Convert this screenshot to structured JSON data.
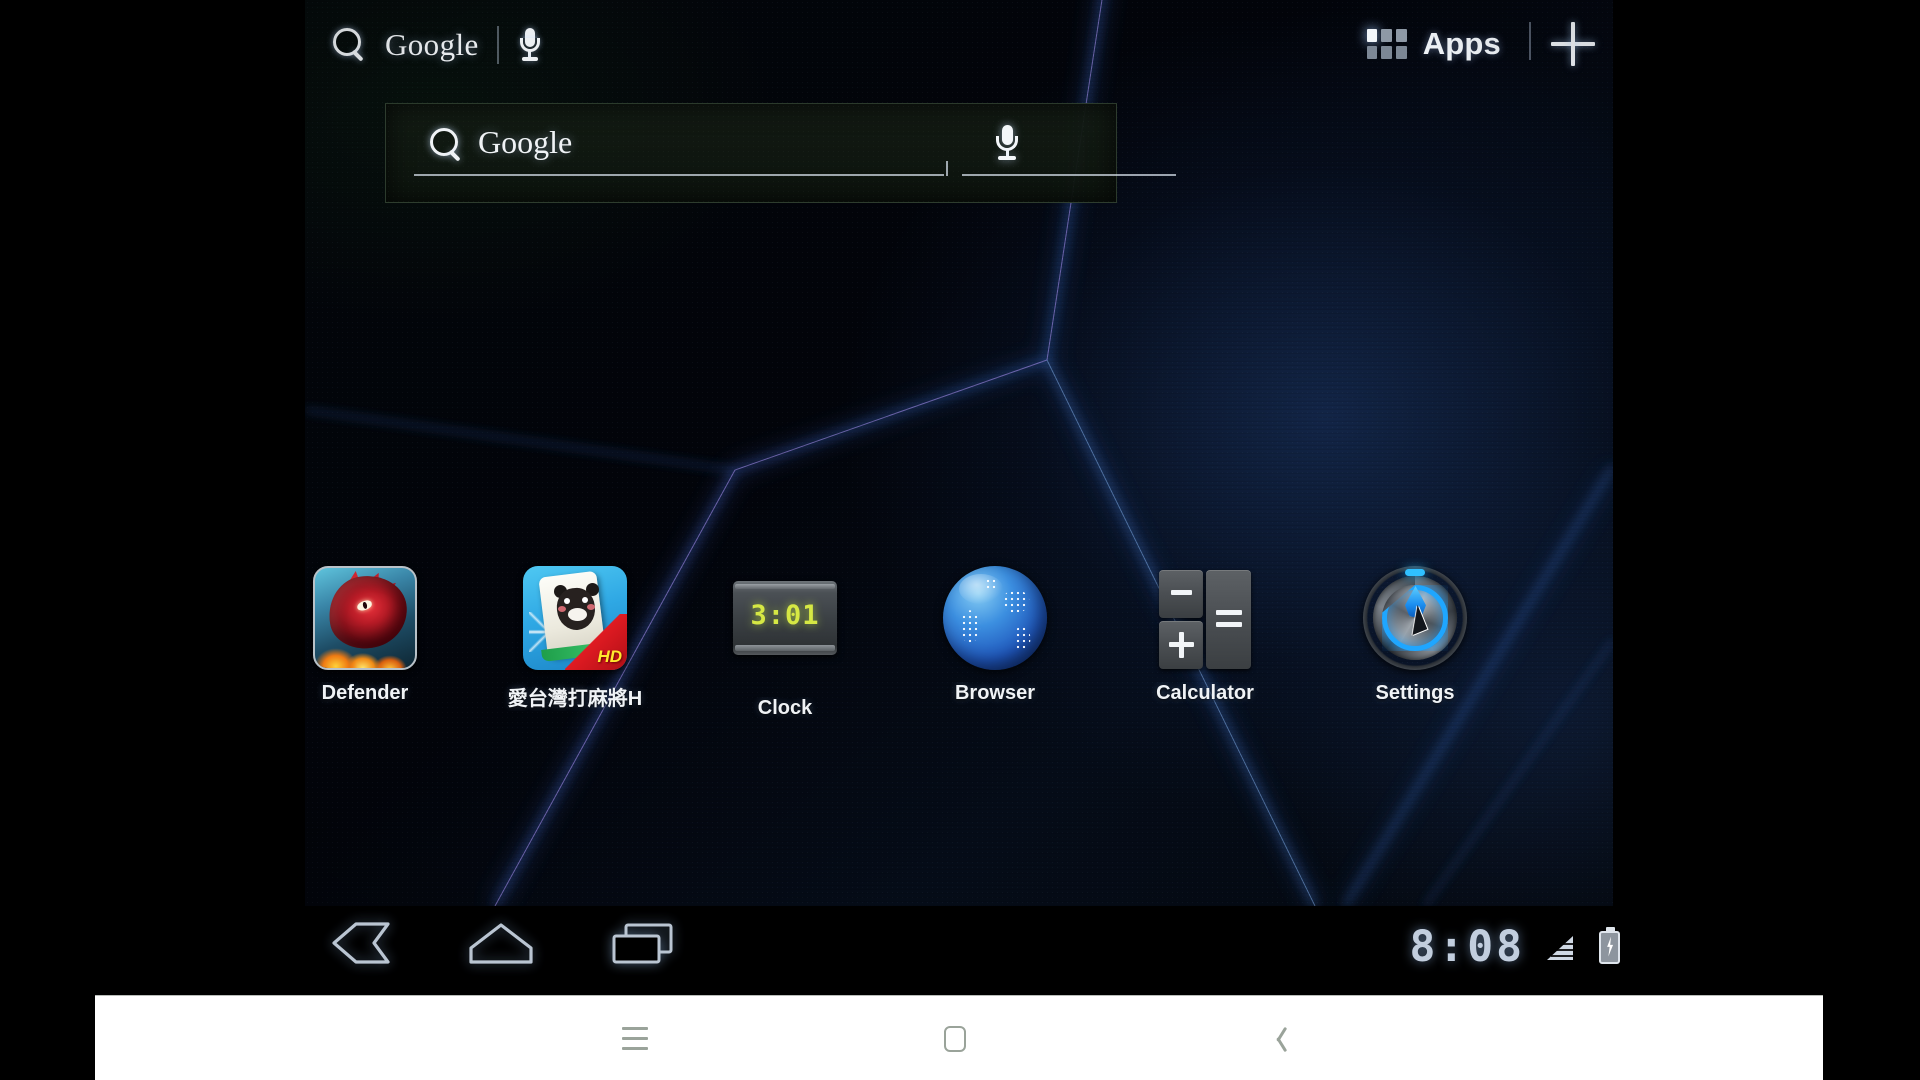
{
  "topbar": {
    "search_label": "Google",
    "search_icon": "search-icon",
    "mic_icon": "microphone-icon",
    "apps_label": "Apps",
    "apps_icon": "grid-icon",
    "add_icon": "plus-icon"
  },
  "search_widget": {
    "placeholder": "Google",
    "search_icon": "search-icon",
    "voice_icon": "microphone-icon"
  },
  "apps": [
    {
      "label": "Defender",
      "icon": "defender-dragon-icon"
    },
    {
      "label": "愛台灣打麻將H",
      "icon": "mahjong-panda-hd-icon",
      "badge": "HD"
    },
    {
      "label": "Clock",
      "icon": "clock-icon",
      "display_time": "3:01"
    },
    {
      "label": "Browser",
      "icon": "globe-icon"
    },
    {
      "label": "Calculator",
      "icon": "calculator-icon"
    },
    {
      "label": "Settings",
      "icon": "settings-dial-icon"
    }
  ],
  "system_bar": {
    "back_icon": "back-arrow-icon",
    "home_icon": "home-icon",
    "recents_icon": "recent-apps-icon",
    "clock": "8:08",
    "signal_icon": "signal-bars-icon",
    "battery_icon": "battery-charging-icon"
  },
  "host_bar": {
    "menu_icon": "menu-hamburger-icon",
    "home_icon": "home-square-icon",
    "back_icon": "back-chevron-icon"
  },
  "colors": {
    "accent_blue": "#1fa6ff",
    "clock_green": "#d6e844",
    "status_text": "#c2cede",
    "wallpaper_dark": "#03060a"
  }
}
